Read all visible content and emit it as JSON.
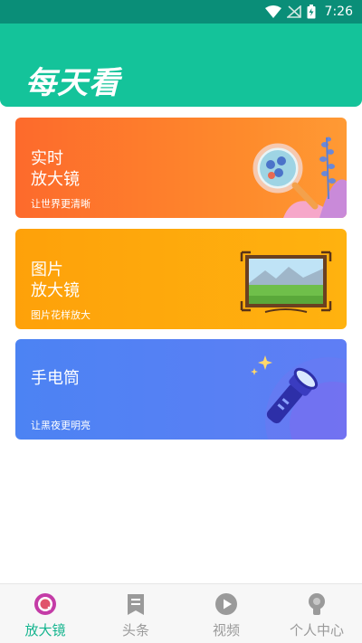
{
  "status_bar": {
    "time": "7:26"
  },
  "header": {
    "title": "每天看"
  },
  "cards": [
    {
      "title": "实时\n放大镜",
      "subtitle": "让世界更清晰"
    },
    {
      "title": "图片\n放大镜",
      "subtitle": "图片花样放大"
    },
    {
      "title": "手电筒",
      "subtitle": "让黑夜更明亮"
    }
  ],
  "bottom_nav": {
    "items": [
      {
        "label": "放大镜",
        "icon": "magnifier-icon",
        "active": true
      },
      {
        "label": "头条",
        "icon": "bookmark-icon",
        "active": false
      },
      {
        "label": "视频",
        "icon": "play-icon",
        "active": false
      },
      {
        "label": "个人中心",
        "icon": "person-icon",
        "active": false
      }
    ]
  },
  "colors": {
    "status_bar": "#0a8e78",
    "header": "#14c39a",
    "card_1": "#fd6a2c",
    "card_2": "#fea10a",
    "card_3": "#4c83f3",
    "nav_active": "#14b48e",
    "nav_inactive": "#9a9a9a"
  }
}
